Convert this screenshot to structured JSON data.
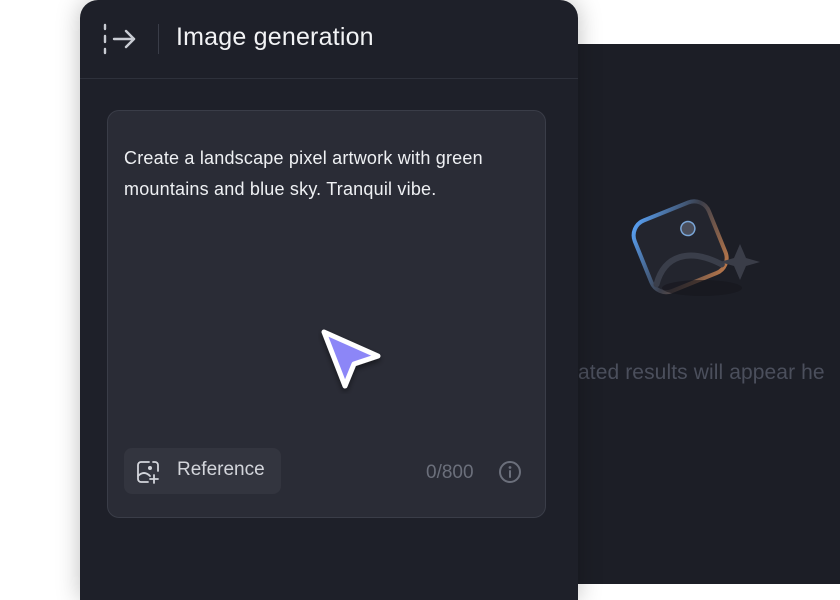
{
  "panel": {
    "title": "Image generation",
    "prompt_text": "Create a landscape pixel artwork with green mountains and blue sky. Tranquil vibe.",
    "reference_label": "Reference",
    "char_count": "0/800"
  },
  "results": {
    "placeholder_text": "ated results will appear he"
  },
  "colors": {
    "panel_bg": "#1e2029",
    "prompt_bg": "#2a2c36",
    "cursor_accent": "#8c86f7"
  }
}
